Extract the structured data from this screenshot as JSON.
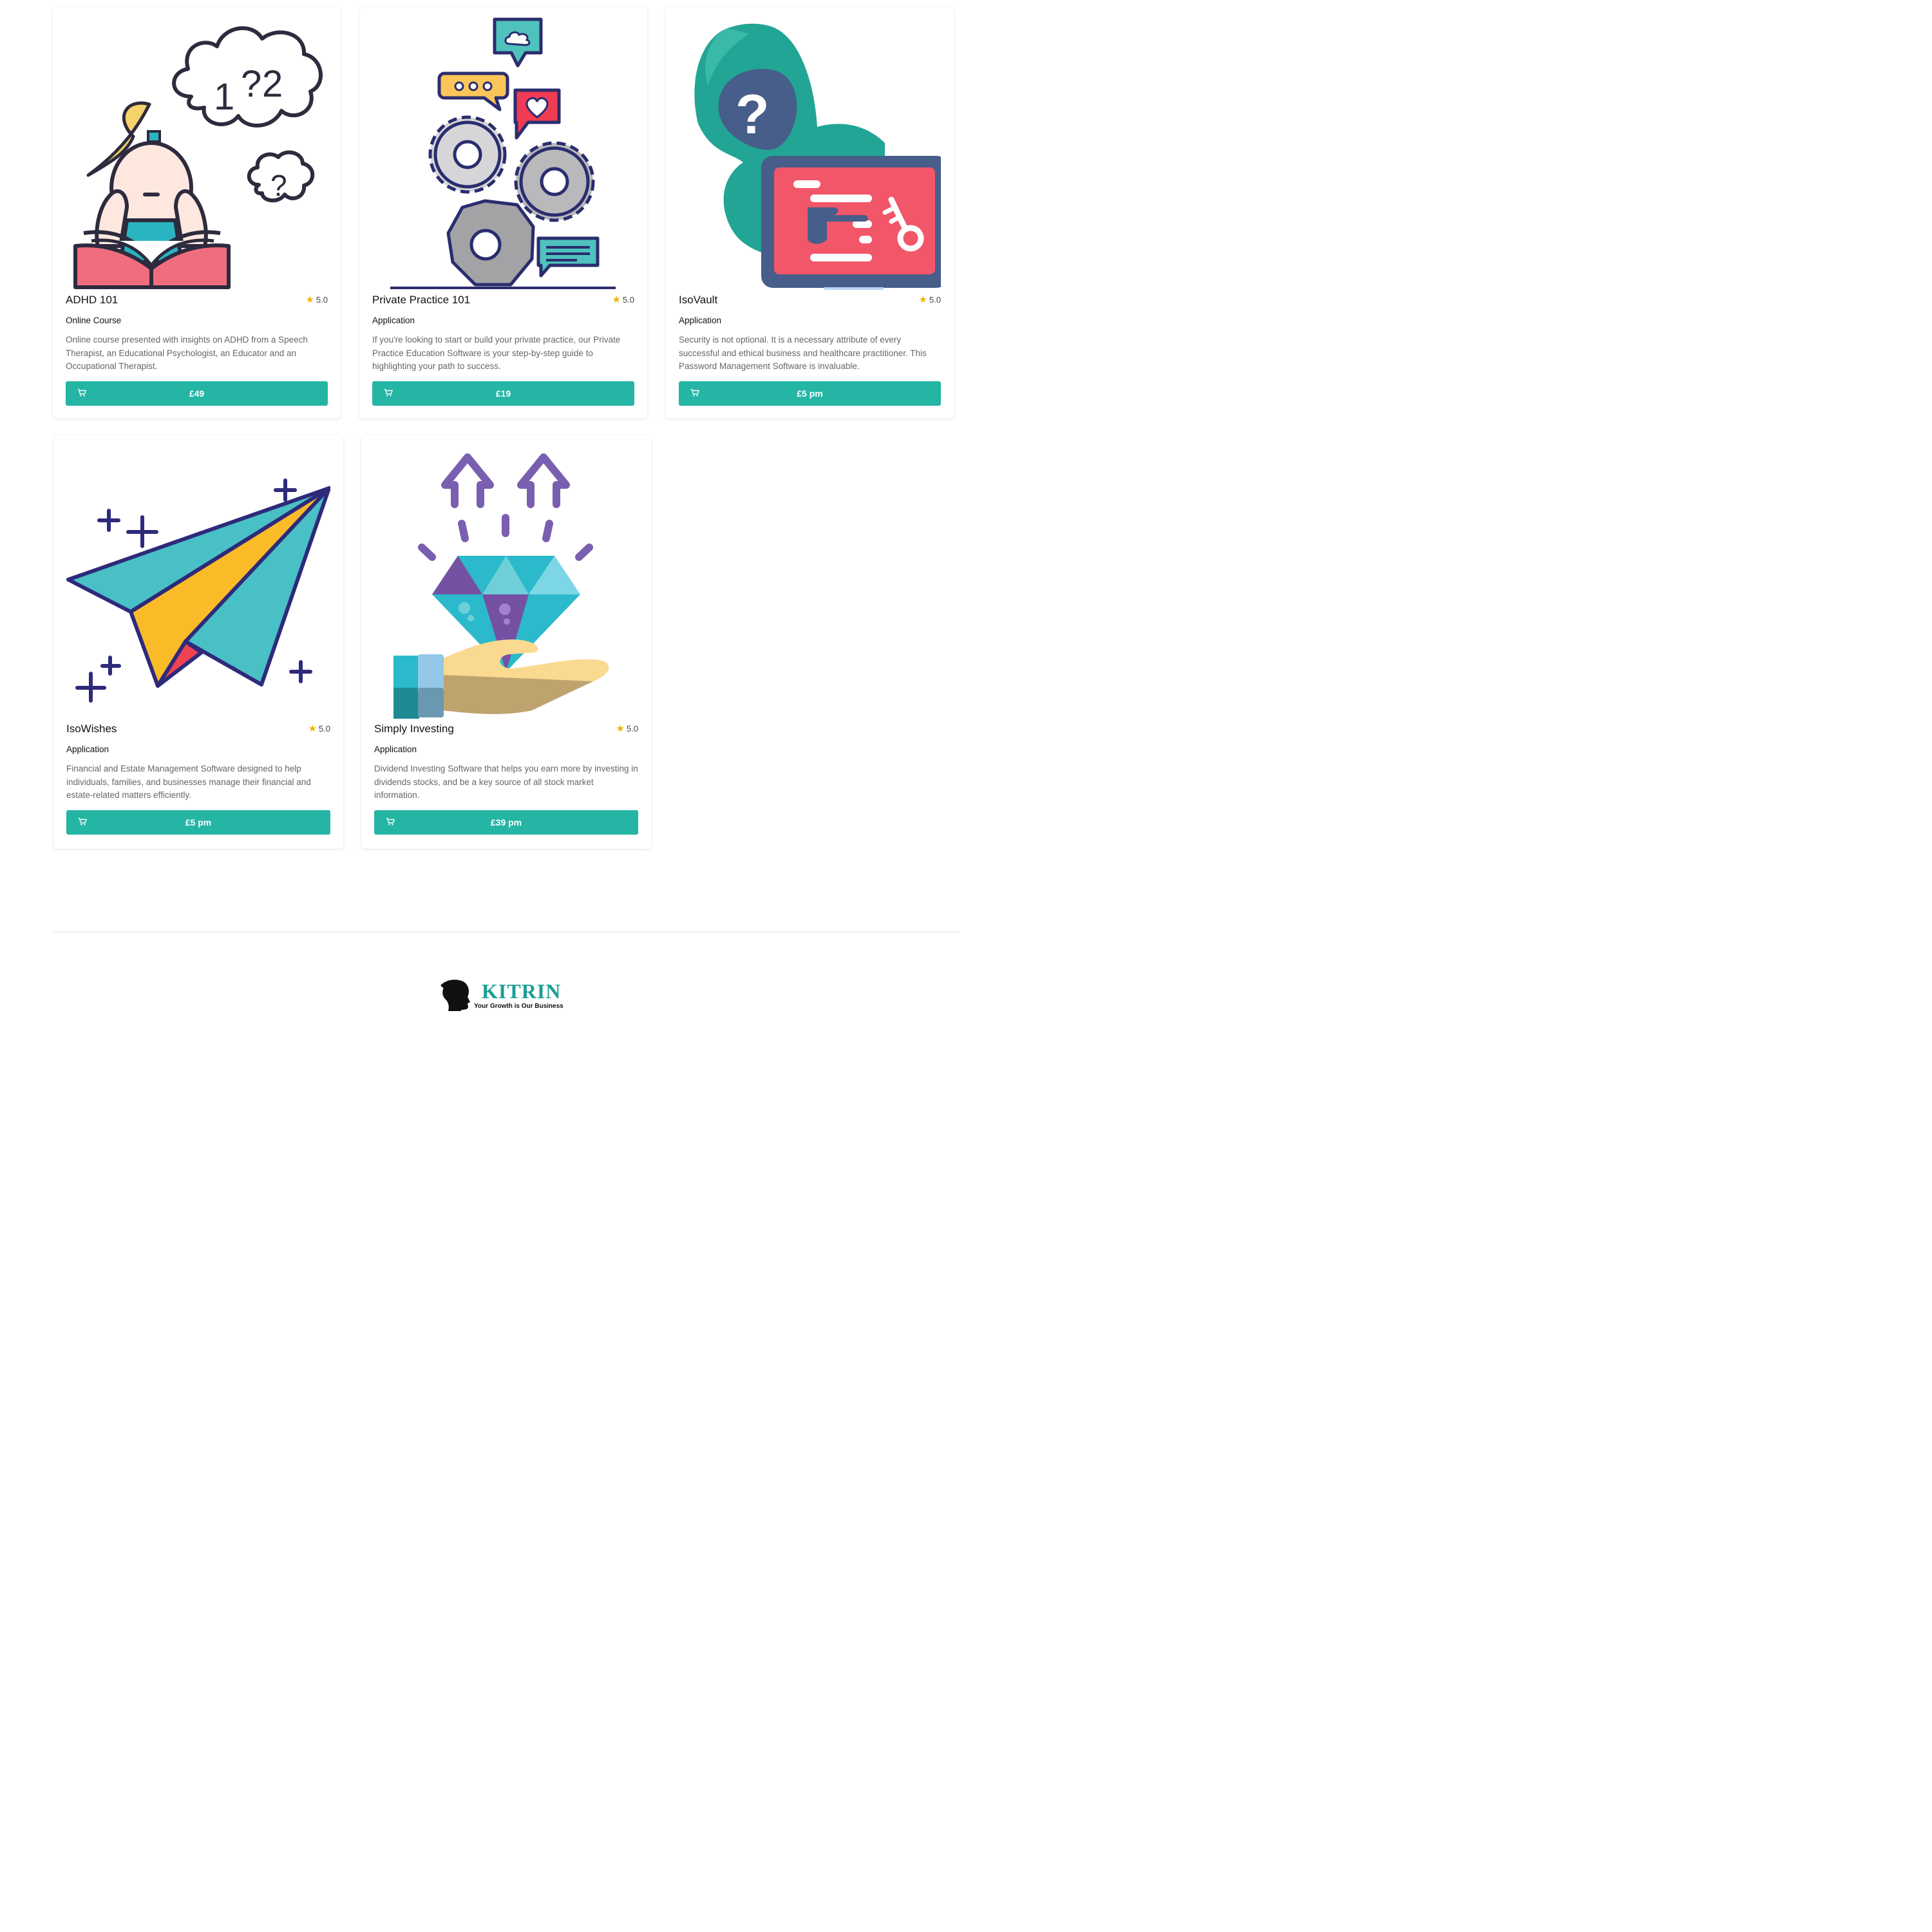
{
  "products": [
    {
      "title": "ADHD 101",
      "rating": "5.0",
      "category": "Online Course",
      "description": "Online course presented with insights on ADHD from a Speech Therapist, an Educational Psychologist, an Educator and an Occupational Therapist.",
      "price": "£49",
      "illustration": "girl-reading-thinking-icon"
    },
    {
      "title": "Private Practice 101",
      "rating": "5.0",
      "category": "Application",
      "description": "If you're looking to start or build your private practice, our Private Practice Education Software is your step-by-step guide to highlighting your path to success.",
      "price": "£19",
      "illustration": "gears-speech-bubbles-icon"
    },
    {
      "title": "IsoVault",
      "rating": "5.0",
      "category": "Application",
      "description": "Security is not optional. It is a necessary attribute of every successful and ethical business and healthcare practitioner. This Password Management Software is invaluable.",
      "price": "£5 pm",
      "illustration": "hooded-figure-key-icon"
    },
    {
      "title": "IsoWishes",
      "rating": "5.0",
      "category": "Application",
      "description": "Financial and Estate Management Software designed to help individuals, families, and businesses manage their financial and estate-related matters efficiently.",
      "price": "£5 pm",
      "illustration": "paper-plane-icon"
    },
    {
      "title": "Simply Investing",
      "rating": "5.0",
      "category": "Application",
      "description": "Dividend Investing Software that helps you earn more by investing in dividends stocks, and be a key source of all stock market information.",
      "price": "£39 pm",
      "illustration": "hand-diamond-arrows-icon"
    }
  ],
  "footer": {
    "brand_name": "KITRIN",
    "tagline": "Your Growth is Our Business"
  },
  "colors": {
    "button": "#25b5a4",
    "star": "#f0b400",
    "brand": "#1d9e95"
  }
}
